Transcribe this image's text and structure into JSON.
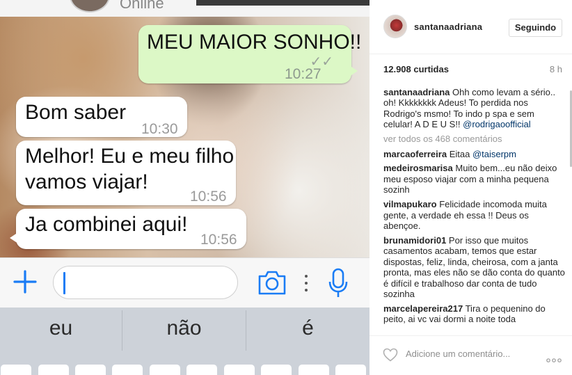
{
  "whatsapp": {
    "contact_status": "Online",
    "messages": [
      {
        "text": "MEU MAIOR SONHO!!",
        "time": "10:27",
        "direction": "outgoing",
        "ticks": "✓✓"
      },
      {
        "text": "Bom saber",
        "time": "10:30",
        "direction": "incoming"
      },
      {
        "text": "Melhor! Eu e meu filho vamos viajar!",
        "line1": "Melhor! Eu e meu filho",
        "line2": "vamos viajar!",
        "time": "10:56",
        "direction": "incoming"
      },
      {
        "text": "Ja combinei aqui!",
        "time": "10:56",
        "direction": "incoming"
      }
    ],
    "input": {
      "value": ""
    },
    "icons": {
      "add": "plus-icon",
      "camera": "camera-icon",
      "more": "vertical-dots-icon",
      "mic": "microphone-icon"
    },
    "suggestions": [
      "eu",
      "não",
      "é"
    ],
    "colors": {
      "outgoing_bubble": "#dcf8c6",
      "incoming_bubble": "#ffffff",
      "accent": "#1a7cf5"
    }
  },
  "instagram": {
    "username": "santanaadriana",
    "follow_label": "Seguindo",
    "likes": "12.908 curtidas",
    "post_age": "8 h",
    "caption": {
      "user": "santanaadriana",
      "text": "Ohh como levam a sério.. oh! Kkkkkkkk Adeus! To perdida nos Rodrigo's msmo! To indo p spa e sem celular! A D E U S!! ",
      "mention": "@rodrigaoofficial"
    },
    "view_all": "ver todos os 468 comentários",
    "comments": [
      {
        "user": "marcaoferreira",
        "text": "Eitaa ",
        "mention": "@taiserpm"
      },
      {
        "user": "medeirosmarisa",
        "text": "Muito bem...eu não deixo meu esposo viajar com a minha pequena sozinh"
      },
      {
        "user": "vilmapukaro",
        "text": "Felicidade incomoda muita gente, a verdade eh essa !! Deus os abençoe."
      },
      {
        "user": "brunamidori01",
        "text": "Por isso que muitos casamentos acabam, temos que estar dispostas, feliz, linda, cheirosa, com a janta pronta, mas eles não se dão conta do quanto é difícil e trabalhoso dar conta de tudo sozinha"
      },
      {
        "user": "marcelapereira217",
        "text": "Tira o pequenino do peito, ai vc vai dormi a noite toda"
      }
    ],
    "add_comment_placeholder": "Adicione um comentário...",
    "icons": {
      "like": "heart-icon",
      "more": "more-options-icon"
    },
    "colors": {
      "text": "#262626",
      "muted": "#999999",
      "mention": "#003569"
    }
  }
}
